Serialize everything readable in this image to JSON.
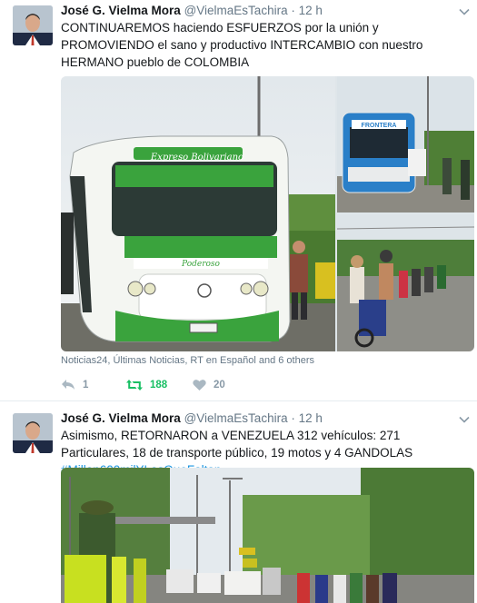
{
  "tweets": [
    {
      "author_name": "José G. Vielma Mora",
      "handle": "@VielmaEsTachira",
      "separator": "·",
      "time": "12 h",
      "text": "CONTINUAREMOS haciendo ESFUERZOS por la unión y PROMOVIENDO el sano y productivo INTERCAMBIO con nuestro HERMANO pueblo de COLOMBIA",
      "media_bus_sign": "Expreso Bolivariano",
      "media_bus_front": "Poderoso",
      "media_bus2_sign": "FRONTERA",
      "credits": "Noticias24, Últimas Noticias, RT en Español and 6 others",
      "reply_count": "1",
      "retweet_count": "188",
      "like_count": "20"
    },
    {
      "author_name": "José G. Vielma Mora",
      "handle": "@VielmaEsTachira",
      "separator": "·",
      "time": "12 h",
      "text": "Asimismo, RETORNARON a VENEZUELA 312 vehículos: 271 Particulares, 18 de transporte público, 19 motos y 4 GANDOLAS ",
      "hashtag": "#Millon600milYLasQueFaltan"
    }
  ],
  "colors": {
    "name": "#14171a",
    "secondary": "#657786",
    "link": "#1b95e0",
    "retweeted": "#17bf63",
    "action_gray": "#8899a6",
    "bus_green": "#3aa33d"
  },
  "icons": [
    "caret-down-icon",
    "reply-icon",
    "retweet-icon",
    "heart-icon"
  ]
}
